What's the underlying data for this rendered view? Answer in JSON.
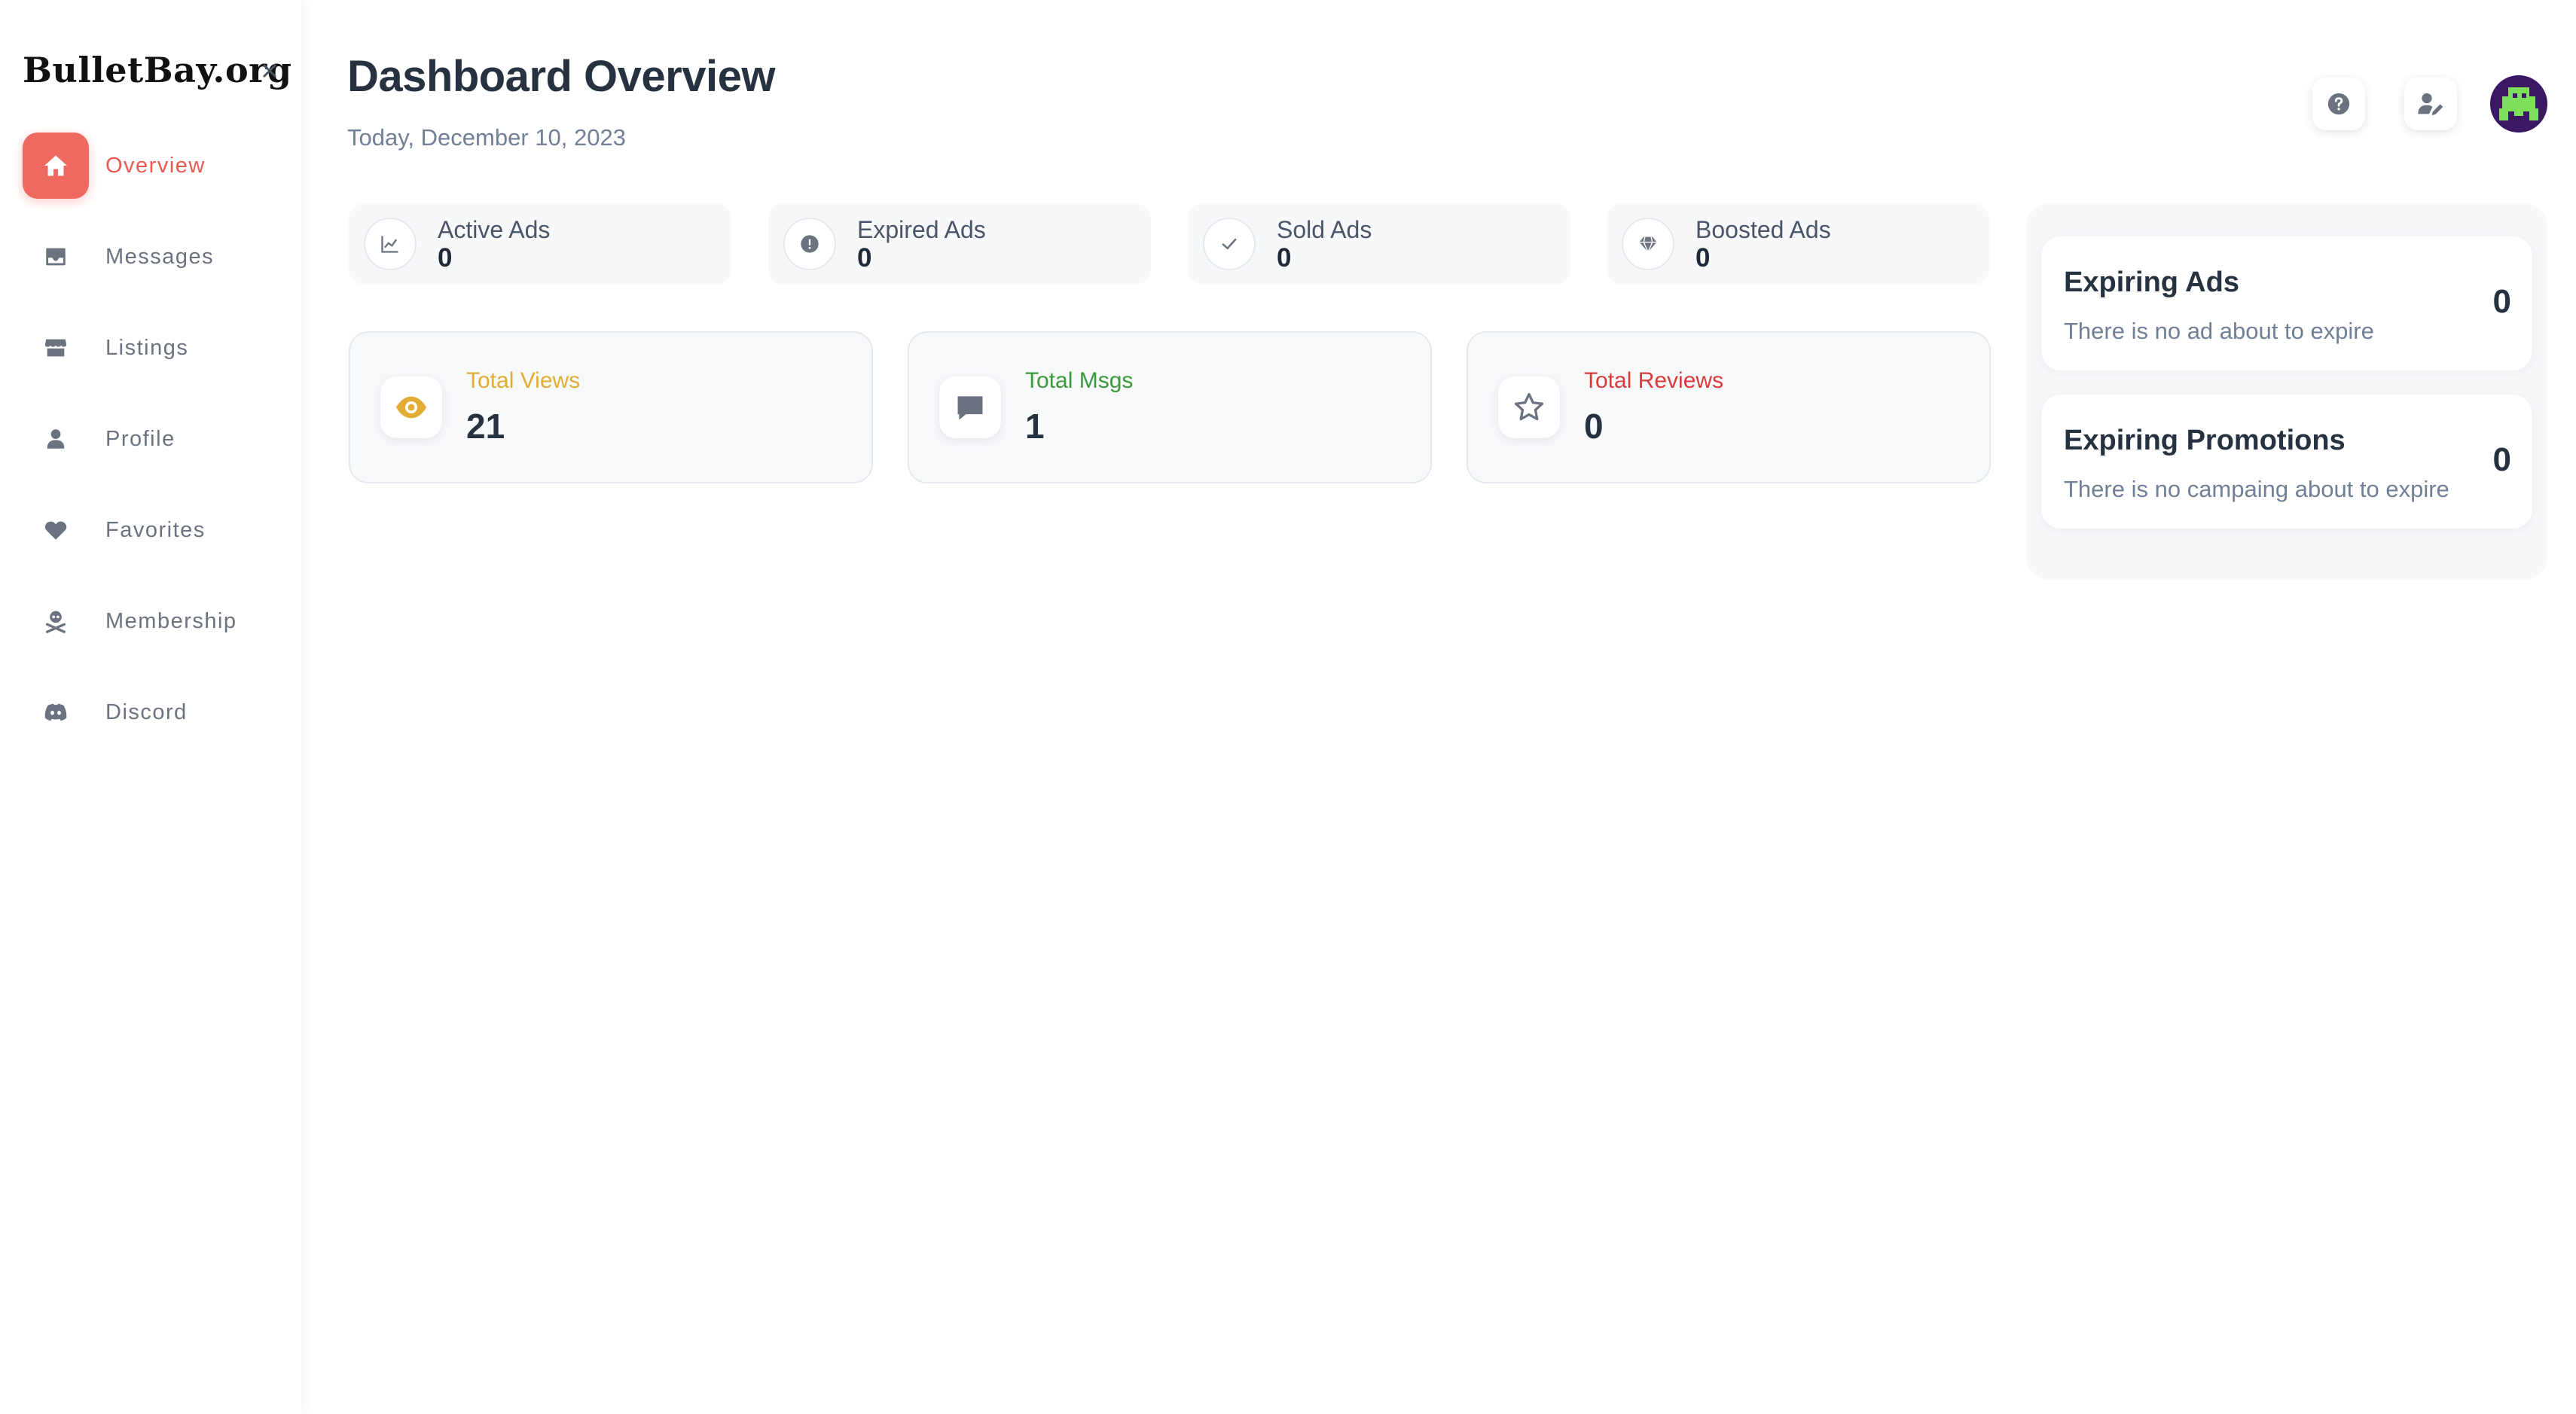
{
  "sidebar": {
    "logo": "BulletBay.org",
    "close_icon": "close-icon",
    "items": [
      {
        "label": "Overview",
        "icon": "home-icon",
        "active": true
      },
      {
        "label": "Messages",
        "icon": "inbox-icon"
      },
      {
        "label": "Listings",
        "icon": "store-icon"
      },
      {
        "label": "Profile",
        "icon": "user-icon"
      },
      {
        "label": "Favorites",
        "icon": "heart-icon"
      },
      {
        "label": "Membership",
        "icon": "skull-crossbones-icon"
      },
      {
        "label": "Discord",
        "icon": "discord-icon"
      }
    ]
  },
  "header": {
    "title": "Dashboard Overview",
    "date": "Today, December 10, 2023",
    "buttons": [
      {
        "icon": "help-icon"
      },
      {
        "icon": "user-edit-icon"
      }
    ],
    "avatar_icon": "avatar-icon"
  },
  "stats": [
    {
      "label": "Active Ads",
      "value": "0",
      "icon": "chart-line-icon"
    },
    {
      "label": "Expired Ads",
      "value": "0",
      "icon": "alert-circle-icon"
    },
    {
      "label": "Sold Ads",
      "value": "0",
      "icon": "check-icon"
    },
    {
      "label": "Boosted Ads",
      "value": "0",
      "icon": "diamond-icon"
    }
  ],
  "totals": [
    {
      "label": "Total Views",
      "value": "21",
      "icon": "eye-icon",
      "color": "#e2ac35"
    },
    {
      "label": "Total Msgs",
      "value": "1",
      "icon": "chat-bubble-icon",
      "color": "#3a9a3a"
    },
    {
      "label": "Total Reviews",
      "value": "0",
      "icon": "star-icon",
      "color": "#d93a3a"
    }
  ],
  "expiring": [
    {
      "title": "Expiring Ads",
      "subtitle": "There is no ad about to expire",
      "count": "0"
    },
    {
      "title": "Expiring Promotions",
      "subtitle": "There is no campaing about to expire",
      "count": "0"
    }
  ],
  "colors": {
    "accent": "#ee6a60",
    "title": "#26323f",
    "muted": "#718096",
    "icon_gray": "#6b7280"
  }
}
